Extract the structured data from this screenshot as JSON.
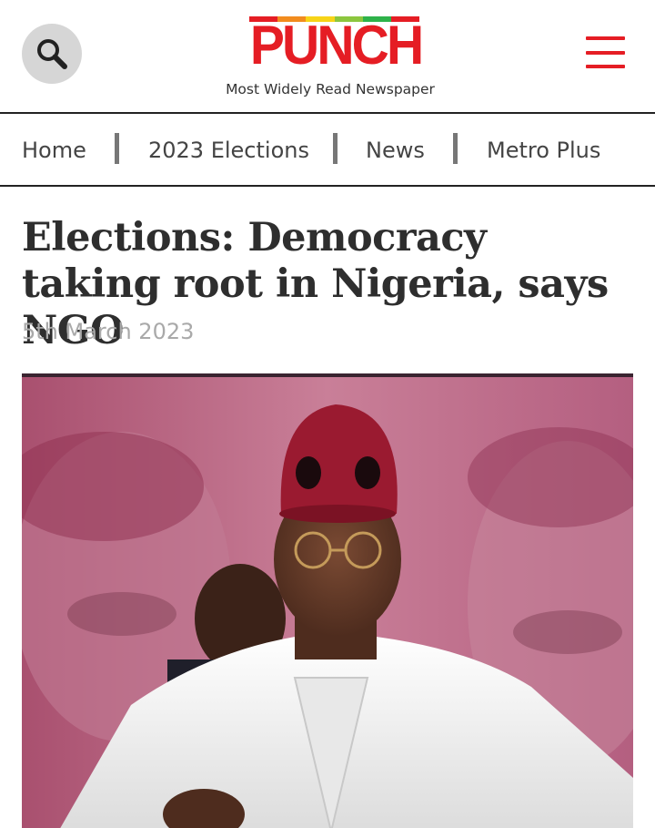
{
  "header": {
    "logo_text": "PUNCH",
    "tagline": "Most Widely Read Newspaper",
    "logo_bar_colors": [
      "#e51d24",
      "#f28c1e",
      "#f7d417",
      "#8cc63e",
      "#2eb24a",
      "#e51d24"
    ],
    "brand_color": "#e51d24",
    "search_icon": "search-icon",
    "menu_icon": "hamburger-menu-icon"
  },
  "nav": {
    "items": [
      {
        "label": "Home"
      },
      {
        "label": "2023 Elections"
      },
      {
        "label": "News"
      },
      {
        "label": "Metro Plus"
      }
    ]
  },
  "article": {
    "headline": "Elections: Democracy taking root in Nigeria, says NGO",
    "date": "5th March 2023"
  }
}
